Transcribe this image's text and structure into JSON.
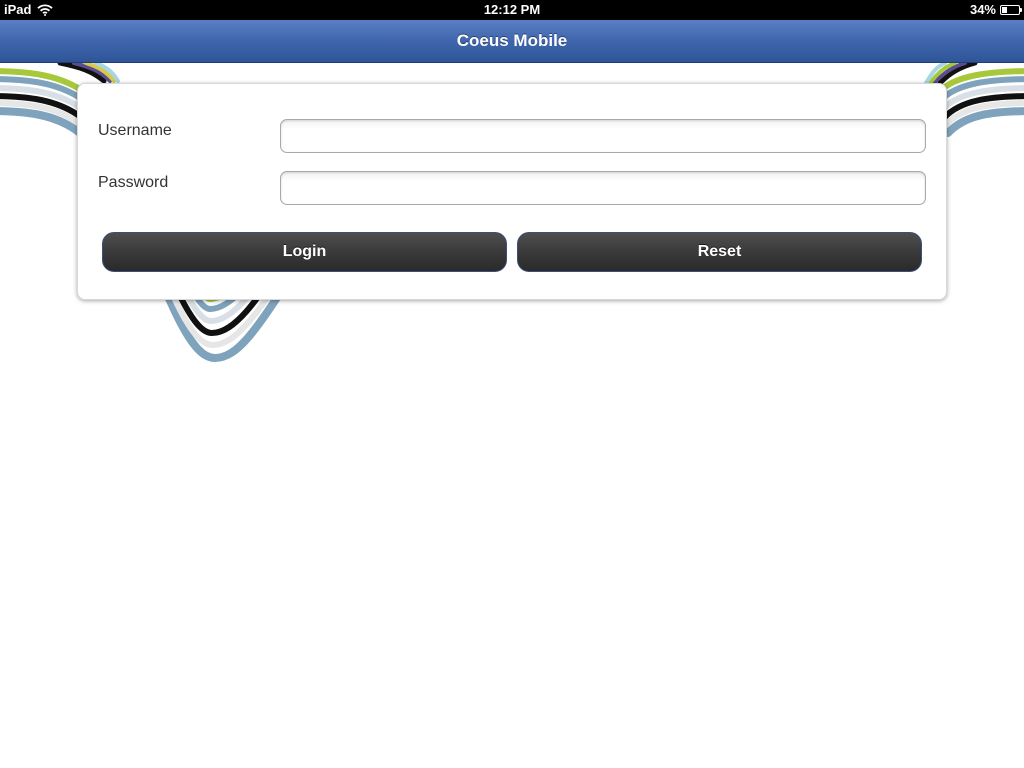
{
  "status_bar": {
    "carrier": "iPad",
    "time": "12:12 PM",
    "battery_percent": "34%",
    "battery_level": 0.34,
    "wifi_icon": "wifi-icon",
    "battery_icon": "battery-icon"
  },
  "nav": {
    "title": "Coeus Mobile"
  },
  "form": {
    "username_label": "Username",
    "username_value": "",
    "password_label": "Password",
    "password_value": "",
    "login_label": "Login",
    "reset_label": "Reset"
  },
  "colors": {
    "nav_bar": "#3f65ac",
    "button": "#3a3a3a",
    "stripe_green": "#a8c83c",
    "stripe_blue": "#7fa3bc",
    "stripe_black": "#111111",
    "stripe_purple": "#5b4d8c"
  }
}
